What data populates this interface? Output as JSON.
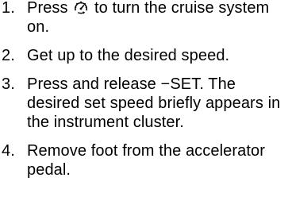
{
  "steps": [
    {
      "number": "1.",
      "text_before_icon": "Press ",
      "icon": "cruise-control-icon",
      "text_after_icon": " to turn the cruise system on."
    },
    {
      "number": "2.",
      "text": "Get up to the desired speed."
    },
    {
      "number": "3.",
      "text": "Press and release −SET. The desired set speed briefly appears in the instrument cluster."
    },
    {
      "number": "4.",
      "text": "Remove foot from the accelerator pedal."
    }
  ]
}
